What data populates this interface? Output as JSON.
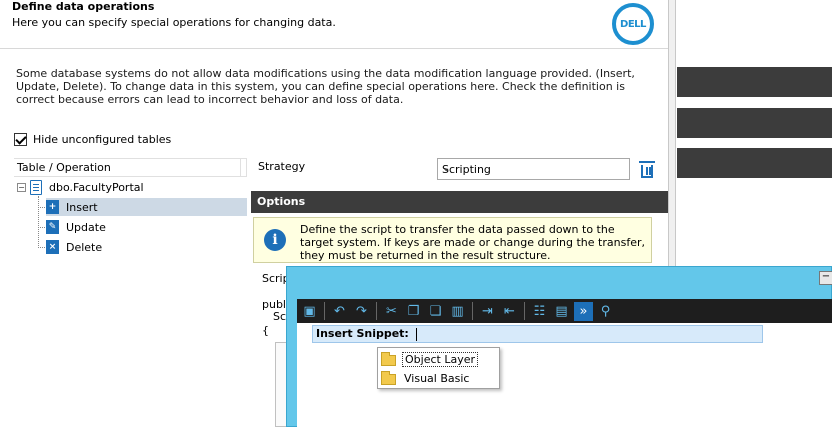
{
  "header": {
    "title": "Define data operations",
    "subtitle": "Here you can specify special operations for changing data.",
    "logo_text": "DELL"
  },
  "description": "Some database systems do not allow data modifications using the data modification language provided. (Insert, Update, Delete). To change data in this system, you can define special operations here. Check the definition is correct because errors can lead to incorrect behavior and loss of data.",
  "hide_unconfigured": {
    "label": "Hide unconfigured tables",
    "checked": true
  },
  "tree": {
    "column_header": "Table / Operation",
    "table": {
      "label": "dbo.FacultyPortal",
      "expander": "−"
    },
    "operations": [
      {
        "label": "Insert",
        "selected": true
      },
      {
        "label": "Update",
        "selected": false
      },
      {
        "label": "Delete",
        "selected": false
      }
    ]
  },
  "strategy": {
    "label": "Strategy",
    "value": "Scripting"
  },
  "options": {
    "title": "Options",
    "info_text": "Define the script to transfer the data passed down to the target system. If keys are made or change during the transfer, they must be returned in the result structure."
  },
  "script": {
    "label": "Script",
    "code_line1": "publi",
    "code_line2": "Scr",
    "code_line3": "{"
  },
  "snippet": {
    "input_label": "Insert Snippet:",
    "minimize": "−",
    "items": [
      {
        "label": "Object Layer",
        "selected": true
      },
      {
        "label": "Visual Basic",
        "selected": false
      }
    ]
  },
  "colors": {
    "accent": "#1d6fb8",
    "dark_bar": "#3c3c3c",
    "snippet_frame": "#63c7ea",
    "info_bg": "#ffffe1"
  }
}
